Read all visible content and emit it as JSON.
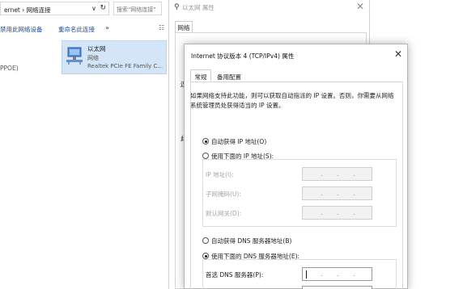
{
  "explorer": {
    "address": "ernet › 网络连接",
    "address_chevron": "∨",
    "refresh_icon": "↻",
    "search_placeholder": "搜索\"网络连接\"",
    "cmd_disable": "禁用此网络设备",
    "cmd_rename": "重命名此连接",
    "cmd_more": "»",
    "view_icon": "☷",
    "left_item": "PPOE)",
    "adapter": {
      "name": "以太网",
      "status": "网络",
      "device": "Realtek PCIe FE Family C..."
    }
  },
  "ethernet_dialog": {
    "title": "以太网 属性",
    "close_icon": "✕",
    "tab": "网络",
    "label_connect": "连",
    "label_this": "此"
  },
  "ipv4_dialog": {
    "title": "Internet 协议版本 4 (TCP/IPv4) 属性",
    "close_icon": "✕",
    "tabs": [
      "常规",
      "备用配置"
    ],
    "description": "如果网络支持此功能，则可以获取自动指派的 IP 设置。否则，你需要从网络系统管理员处获得适当的 IP 设置。",
    "ip_auto_label": "自动获得 IP 地址(O)",
    "ip_manual_label": "使用下面的 IP 地址(S):",
    "ip_auto_selected": true,
    "ip_fields": [
      {
        "label": "IP 地址(I):",
        "value": "."
      },
      {
        "label": "子网掩码(U):",
        "value": "."
      },
      {
        "label": "默认网关(D):",
        "value": "."
      }
    ],
    "dns_auto_label": "自动获得 DNS 服务器地址(B)",
    "dns_manual_label": "使用下面的 DNS 服务器地址(E):",
    "dns_manual_selected": true,
    "dns_preferred_label": "首选 DNS 服务器(P):",
    "dot": "."
  }
}
